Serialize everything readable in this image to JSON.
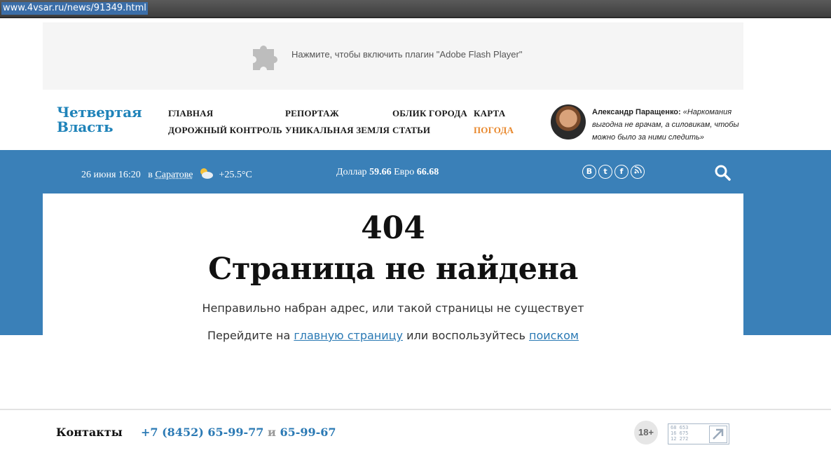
{
  "browser": {
    "url": "www.4vsar.ru/news/91349.html"
  },
  "flash": {
    "message": "Нажмите, чтобы включить плагин \"Adobe Flash Player\"",
    "icon": "puzzle-icon"
  },
  "header": {
    "logo_line1": "Четвертая",
    "logo_line2": "Власть",
    "nav": [
      {
        "label": "ГЛАВНАЯ"
      },
      {
        "label": "ДОРОЖНЫЙ КОНТРОЛЬ"
      },
      {
        "label": "РЕПОРТАЖ"
      },
      {
        "label": "УНИКАЛЬНАЯ ЗЕМЛЯ"
      },
      {
        "label": "ОБЛИК ГОРОДА"
      },
      {
        "label": "СТАТЬИ"
      },
      {
        "label": "КАРТА"
      },
      {
        "label": "ПОГОДА"
      }
    ],
    "quote": {
      "author": "Александр Паращенко:",
      "text": "«Наркомания выгодна не врачам, а силовикам, чтобы можно было за ними следить»"
    }
  },
  "infobar": {
    "date": "26 июня 16:20",
    "in_label": "в",
    "city": "Саратове",
    "temperature": "+25.5°C",
    "dollar_label": "Доллар",
    "dollar_value": "59.66",
    "euro_label": "Евро",
    "euro_value": "66.68",
    "social": [
      "В",
      "t",
      "f",
      "rss"
    ]
  },
  "error": {
    "code": "404",
    "title": "Страница не найдена",
    "description": "Неправильно набран адрес, или такой страницы не существует",
    "hint_prefix": "Перейдите на",
    "hint_link1": "главную страницу",
    "hint_middle": "или воспользуйтесь",
    "hint_link2": "поиском"
  },
  "footer": {
    "contacts_label": "Контакты",
    "phone1": "+7 (8452) 65-99-77",
    "and": "и",
    "phone2": "65-99-67",
    "age_badge": "18+",
    "counter_lines": [
      "68 653",
      "16 675",
      "12 272"
    ]
  },
  "colors": {
    "brand_blue": "#1f83b9",
    "band_blue": "#3a80b8",
    "link_blue": "#2a79b4",
    "accent_orange": "#e8872b"
  }
}
